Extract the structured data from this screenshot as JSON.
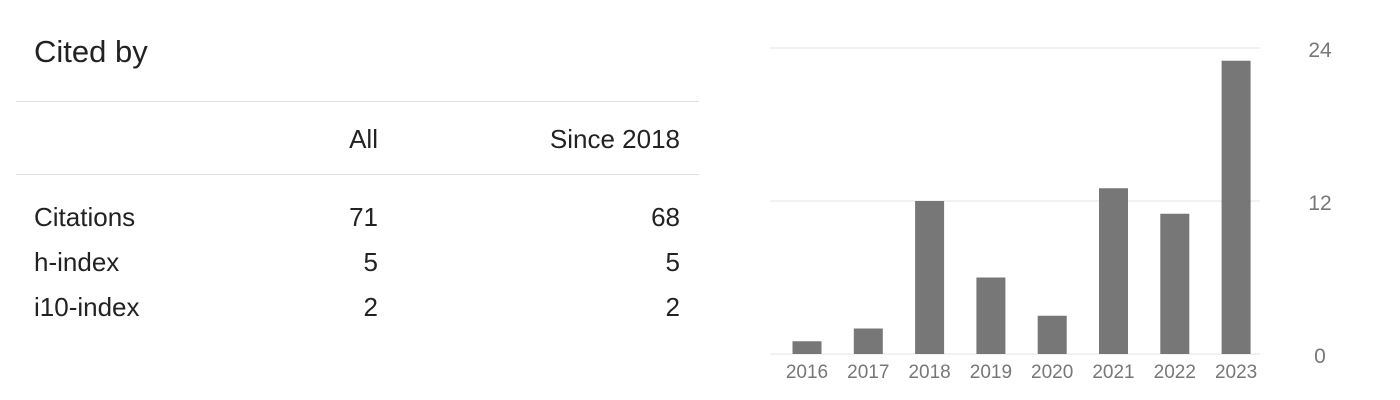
{
  "header": {
    "title": "Cited by"
  },
  "table": {
    "columns": [
      "",
      "All",
      "Since 2018"
    ],
    "rows": [
      {
        "label": "Citations",
        "all": "71",
        "since": "68"
      },
      {
        "label": "h-index",
        "all": "5",
        "since": "5"
      },
      {
        "label": "i10-index",
        "all": "2",
        "since": "2"
      }
    ]
  },
  "colors": {
    "bar": "#777777",
    "grid": "#e6e6e6",
    "axis_text": "#777777",
    "text": "#222222"
  },
  "chart_data": {
    "type": "bar",
    "categories": [
      "2016",
      "2017",
      "2018",
      "2019",
      "2020",
      "2021",
      "2022",
      "2023"
    ],
    "values": [
      1,
      2,
      12,
      6,
      3,
      13,
      11,
      23
    ],
    "title": "",
    "xlabel": "",
    "ylabel": "",
    "ylim": [
      0,
      24
    ],
    "yticks": [
      "0",
      "12",
      "24"
    ],
    "grid": true,
    "yaxis_side": "right"
  }
}
